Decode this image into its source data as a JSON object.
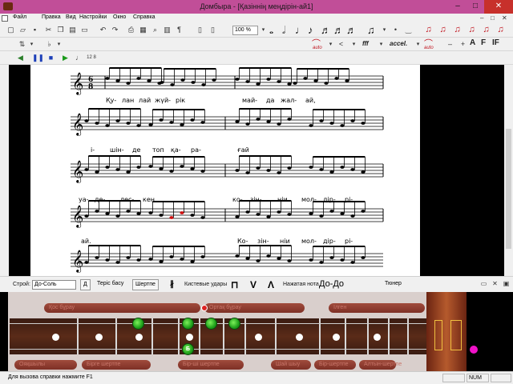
{
  "window": {
    "title": "Домбыра - [Қазіннің меңдірін-ай1]",
    "minimize": "–",
    "maximize": "□",
    "close": "✕"
  },
  "menu": {
    "items": [
      "Файл",
      "Правка",
      "Вид",
      "Настройки",
      "Окно",
      "Справка"
    ],
    "right_controls": [
      "–",
      "□",
      "✕"
    ]
  },
  "toolbar": {
    "zoom": "100 %",
    "auto_labels": [
      "auto",
      "auto"
    ],
    "accel": "accel.",
    "ff": "fff",
    "font_buttons": [
      "A",
      "F",
      "IF"
    ],
    "time_sig": "12 8"
  },
  "score": {
    "time_signature": [
      "6",
      "8"
    ],
    "lyrics": [
      [
        "Қу-",
        "лан",
        "лай",
        "жүй-",
        "рік",
        "май-",
        "да",
        "жал-",
        "ай,"
      ],
      [
        "і-",
        "шін-",
        "де",
        "топ",
        "қа-",
        "ра-",
        "ғай"
      ],
      [
        "уа-",
        "де-",
        "лес-",
        "кен,",
        "ко-",
        "зін-",
        "ніи",
        "мол-",
        "дір-",
        "рі-"
      ],
      [
        "ай.",
        "Ко-",
        "зін-",
        "ніи",
        "мол-",
        "дір-",
        "рі-"
      ]
    ]
  },
  "controls": {
    "stroy_label": "Строй:",
    "stroy_value": "До-Соль",
    "d_button": "Д",
    "reverse_bass": "Теріс басу",
    "shertpe": "Шертпе",
    "strike_label": "Кистевые удары",
    "strike_buttons": [
      "⊓",
      "V",
      "Λ"
    ],
    "pressed_note_label": "Нажатая нота",
    "pressed_note_value": "До-До",
    "tuner": "Тюнер"
  },
  "fretboard": {
    "top_planks": [
      "Қос бұрау",
      "Ортақ бұрау",
      "Ілген"
    ],
    "bottom_planks": [
      "Ояқшылы",
      "Бірге шертпе",
      "Бір-ші шертпе",
      "Шай шыу",
      "Бір-шертпе",
      "Алтын-шертпе"
    ],
    "green_markers": [
      "",
      "",
      "",
      "",
      "Б"
    ]
  },
  "status": {
    "help": "Для вызова справки нажмите F1",
    "num": "NUM"
  }
}
